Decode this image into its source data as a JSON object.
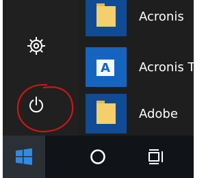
{
  "start_menu": {
    "left_rail": {
      "settings_icon": "gear-icon",
      "power_icon": "power-icon",
      "annotation": "red hand-drawn circle around power button"
    },
    "apps": [
      {
        "label": "Acronis",
        "icon": "folder-icon",
        "tile_color": "#0f4c95"
      },
      {
        "label": "Acronis T",
        "icon": "acronis-app-icon",
        "tile_color": "#1565c0"
      },
      {
        "label": "Adobe",
        "icon": "folder-icon",
        "tile_color": "#0f4c95"
      }
    ]
  },
  "taskbar": {
    "start_icon": "windows-logo-icon",
    "cortana_icon": "cortana-circle-icon",
    "taskview_icon": "task-view-icon",
    "accent_color": "#2e8be6"
  },
  "colors": {
    "menu_background": "#1e1e1e",
    "annotation_red": "#d01515"
  }
}
